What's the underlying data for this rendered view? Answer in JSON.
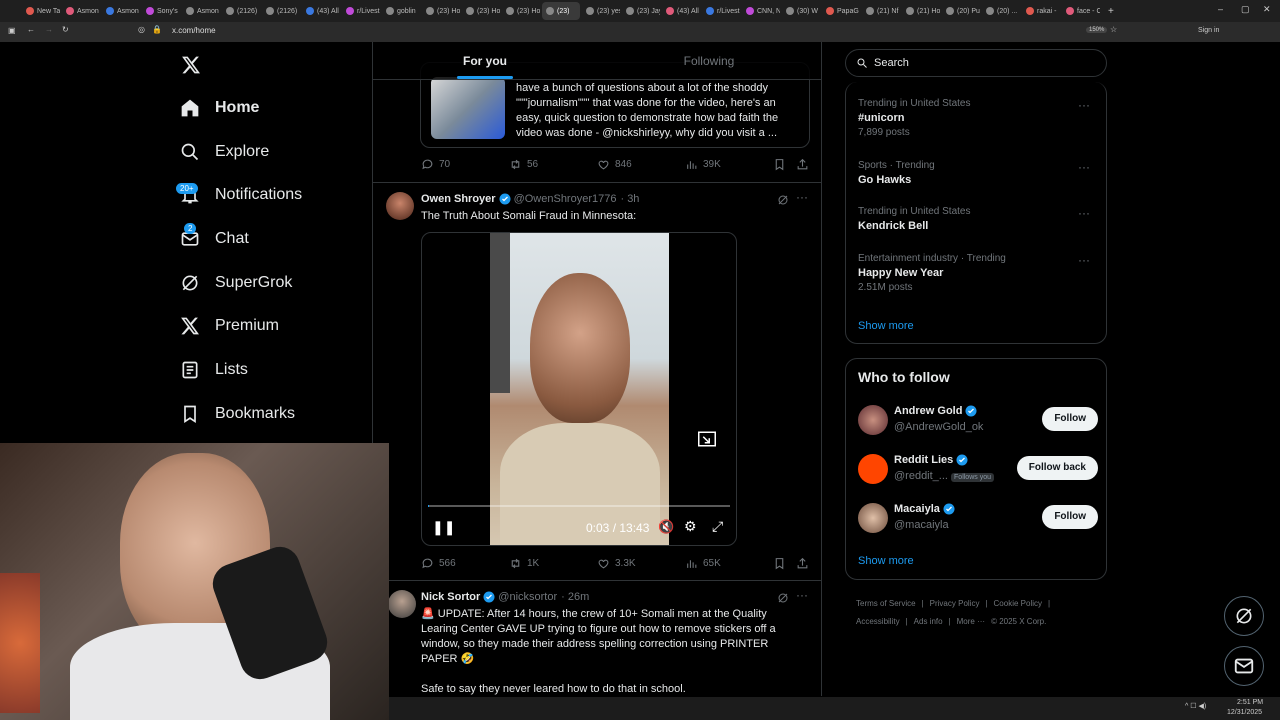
{
  "browser": {
    "tabs": [
      "New Ta",
      "Asmon",
      "Asmon",
      "Sony's",
      "Asmon",
      "(2126)",
      "(2126)",
      "(43) All",
      "r/Livest",
      "goblin",
      "(23) Ho",
      "(23) Ho",
      "(23) Ho",
      "(23)",
      "(23) yes",
      "(23) Jay",
      "(43) All",
      "r/Livest",
      "CNN, N",
      "(30) W",
      "PapaG",
      "(21) Nf",
      "(21) Ho",
      "(20) Pu",
      "(20) ...",
      "rakai -",
      "face - C"
    ],
    "url": "x.com/home",
    "zoom": "150%",
    "sign_in": "Sign in"
  },
  "nav": {
    "items": [
      {
        "label": "Home",
        "icon": "home-icon"
      },
      {
        "label": "Explore",
        "icon": "search-icon"
      },
      {
        "label": "Notifications",
        "icon": "bell-icon",
        "badge": "20+"
      },
      {
        "label": "Chat",
        "icon": "mail-icon",
        "badge": "2"
      },
      {
        "label": "SuperGrok",
        "icon": "grok-icon"
      },
      {
        "label": "Premium",
        "icon": "x-logo-icon"
      },
      {
        "label": "Lists",
        "icon": "list-icon"
      },
      {
        "label": "Bookmarks",
        "icon": "bookmark-icon"
      }
    ]
  },
  "feed": {
    "tabs": [
      "For you",
      "Following"
    ],
    "quoted_text": "have a bunch of questions about a lot of the shoddy \"\"\"journalism\"\"\" that was done for the video, here's an easy, quick question to demonstrate how bad faith the video was done - @nickshirleyy, why did you visit a ...",
    "tweet0_stats": {
      "replies": "70",
      "retweets": "56",
      "likes": "846",
      "views": "39K"
    },
    "tweet1": {
      "name": "Owen Shroyer",
      "handle": "@OwenShroyer1776",
      "time": "· 3h",
      "text": "The Truth About Somali Fraud in Minnesota:",
      "video_time": "0:03 / 13:43",
      "video_progress": 0.004,
      "stats": {
        "replies": "566",
        "retweets": "1K",
        "likes": "3.3K",
        "views": "65K"
      }
    },
    "tweet2": {
      "name": "Nick Sortor",
      "handle": "@nicksortor",
      "time": "· 26m",
      "text": "🚨 UPDATE: After 14 hours, the crew of 10+ Somali men at the Quality Learing Center GAVE UP trying to figure out how to remove stickers off a window, so they made their address spelling correction using PRINTER PAPER 🤣",
      "text2": "Safe to say they never leared how to do that in school."
    }
  },
  "right": {
    "search_placeholder": "Search",
    "trends": [
      {
        "meta": "Trending in United States",
        "title": "#unicorn",
        "count": "7,899 posts"
      },
      {
        "meta": "Sports · Trending",
        "title": "Go Hawks",
        "count": ""
      },
      {
        "meta": "Trending in United States",
        "title": "Kendrick Bell",
        "count": ""
      },
      {
        "meta": "Entertainment industry · Trending",
        "title": "Happy New Year",
        "count": "2.51M posts"
      }
    ],
    "show_more": "Show more",
    "wtf_title": "Who to follow",
    "follow": [
      {
        "name": "Andrew Gold",
        "handle": "@AndrewGold_ok",
        "button": "Follow",
        "extra": ""
      },
      {
        "name": "Reddit Lies",
        "handle": "@reddit_...",
        "button": "Follow back",
        "extra": "Follows you"
      },
      {
        "name": "Macaiyla",
        "handle": "@macaiyla",
        "button": "Follow",
        "extra": ""
      }
    ],
    "show_more2": "Show more",
    "footer": [
      "Terms of Service",
      "|",
      "Privacy Policy",
      "|",
      "Cookie Policy",
      "|",
      "Accessibility",
      "|",
      "Ads info",
      "|",
      "More ···",
      "© 2025 X Corp."
    ]
  },
  "taskbar": {
    "time": "2:51 PM",
    "date": "12/31/2025"
  },
  "colors": {
    "accent": "#1d9bf0",
    "border": "#2f3336",
    "muted": "#71767b"
  }
}
